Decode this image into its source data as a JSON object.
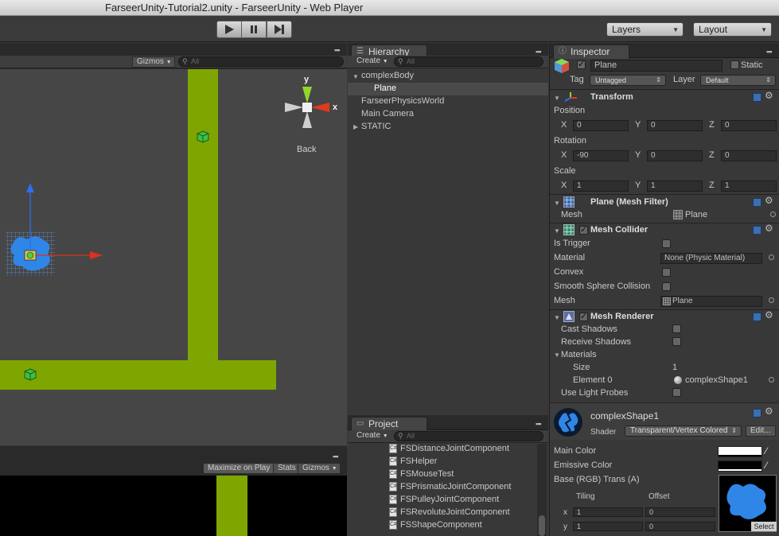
{
  "window": {
    "title": "FarseerUnity-Tutorial2.unity - FarseerUnity - Web Player"
  },
  "toolbar": {
    "layers_label": "Layers",
    "layout_label": "Layout"
  },
  "scene": {
    "gizmos_label": "Gizmos",
    "search_placeholder": "All",
    "gizmo_y": "y",
    "gizmo_x": "x",
    "view_label": "Back",
    "green": "#7fa600"
  },
  "game": {
    "maximize_label": "Maximize on Play",
    "stats_label": "Stats",
    "gizmos_label": "Gizmos"
  },
  "hierarchy": {
    "tab_label": "Hierarchy",
    "create_label": "Create",
    "search_placeholder": "All",
    "items": [
      "complexBody",
      "Plane",
      "FarseerPhysicsWorld",
      "Main Camera",
      "STATIC"
    ]
  },
  "project": {
    "tab_label": "Project",
    "create_label": "Create",
    "search_placeholder": "All",
    "files": [
      "FSDistanceJointComponent",
      "FSHelper",
      "FSMouseTest",
      "FSPrismaticJointComponent",
      "FSPulleyJointComponent",
      "FSRevoluteJointComponent",
      "FSShapeComponent"
    ]
  },
  "inspector": {
    "tab_label": "Inspector",
    "object_name": "Plane",
    "static_label": "Static",
    "tag_label": "Tag",
    "tag_value": "Untagged",
    "layer_label": "Layer",
    "layer_value": "Default",
    "transform": {
      "title": "Transform",
      "position_label": "Position",
      "rotation_label": "Rotation",
      "scale_label": "Scale",
      "x": "X",
      "y": "Y",
      "z": "Z",
      "position": [
        "0",
        "0",
        "0"
      ],
      "rotation": [
        "-90",
        "0",
        "0"
      ],
      "scale": [
        "1",
        "1",
        "1"
      ]
    },
    "mesh_filter": {
      "title": "Plane (Mesh Filter)",
      "mesh_label": "Mesh",
      "mesh_value": "Plane"
    },
    "mesh_collider": {
      "title": "Mesh Collider",
      "is_trigger_label": "Is Trigger",
      "material_label": "Material",
      "material_value": "None (Physic Material)",
      "convex_label": "Convex",
      "smooth_label": "Smooth Sphere Collision",
      "mesh_label": "Mesh",
      "mesh_value": "Plane"
    },
    "mesh_renderer": {
      "title": "Mesh Renderer",
      "cast_label": "Cast Shadows",
      "receive_label": "Receive Shadows",
      "materials_label": "Materials",
      "size_label": "Size",
      "size_value": "1",
      "element_label": "Element 0",
      "element_value": "complexShape1",
      "probes_label": "Use Light Probes"
    },
    "material": {
      "name": "complexShape1",
      "shader_label": "Shader",
      "shader_value": "Transparent/Vertex Colored",
      "edit_label": "Edit...",
      "main_color_label": "Main Color",
      "emissive_label": "Emissive Color",
      "base_label": "Base (RGB) Trans (A)",
      "tiling_label": "Tiling",
      "offset_label": "Offset",
      "x_label": "x",
      "y_label": "y",
      "tiling_x": "1",
      "tiling_y": "1",
      "offset_x": "0",
      "offset_y": "0",
      "select_label": "Select"
    }
  }
}
